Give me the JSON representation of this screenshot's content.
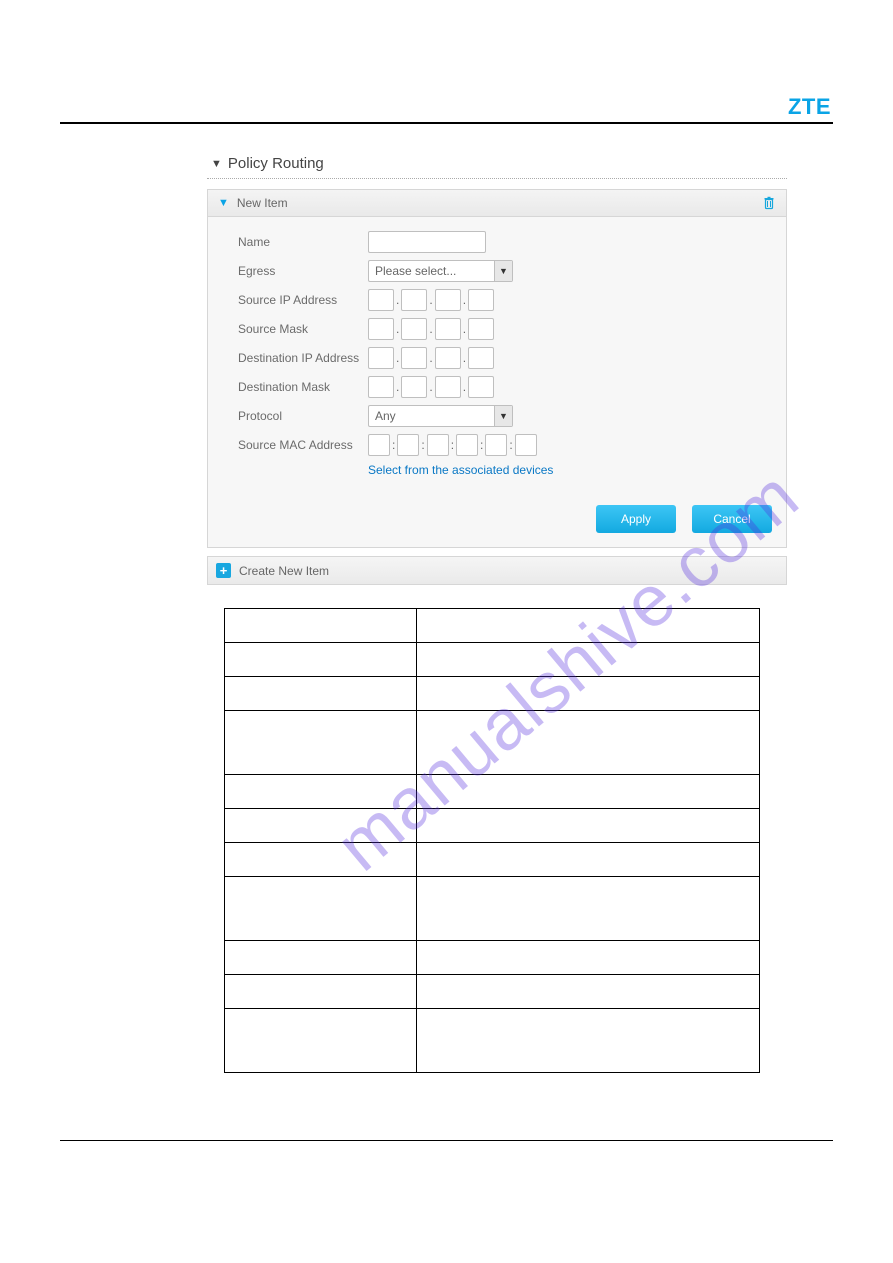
{
  "brand": "ZTE",
  "section": {
    "title": "Policy Routing"
  },
  "panel": {
    "title": "New Item",
    "fields": {
      "name_label": "Name",
      "name_value": "",
      "egress_label": "Egress",
      "egress_selected": "Please select...",
      "src_ip_label": "Source IP Address",
      "src_mask_label": "Source Mask",
      "dst_ip_label": "Destination IP Address",
      "dst_mask_label": "Destination Mask",
      "protocol_label": "Protocol",
      "protocol_selected": "Any",
      "src_mac_label": "Source MAC Address",
      "assoc_link_text": "Select from the associated devices"
    },
    "actions": {
      "apply": "Apply",
      "cancel": "Cancel"
    }
  },
  "create_new": "Create New Item",
  "watermark": "manualshive.com"
}
